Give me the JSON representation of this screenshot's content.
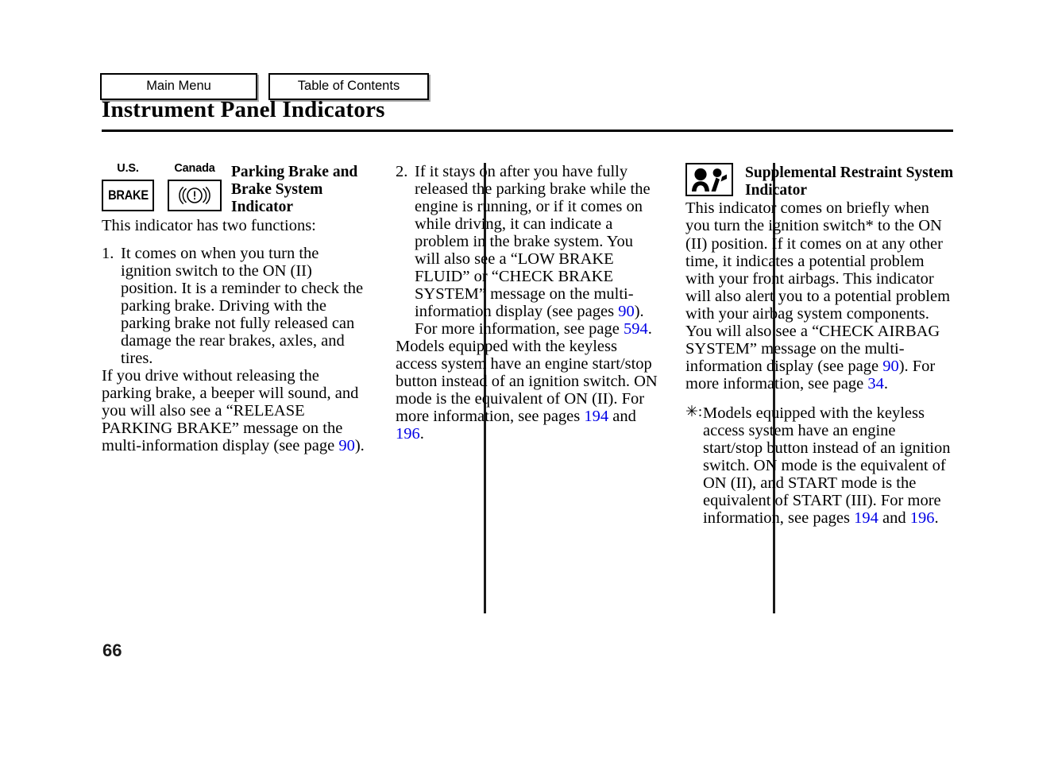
{
  "nav": {
    "main_menu": "Main Menu",
    "table_of_contents": "Table of Contents"
  },
  "page_title": "Instrument Panel Indicators",
  "folio": "66",
  "colors": {
    "link": "#0000e6",
    "rule": "#000000"
  },
  "column_1": {
    "icons": [
      {
        "region": "U.S.",
        "icon_name": "brake-text-indicator",
        "glyph_text": "BRAKE"
      },
      {
        "region": "Canada",
        "icon_name": "brake-circle-exclamation-indicator",
        "glyph_text": ""
      }
    ],
    "heading": "Parking Brake and Brake System Indicator",
    "intro": "This indicator has two functions:",
    "item_1_number": "1.",
    "item_1_text": "It comes on when you turn the ignition switch to the ON (II) position. It is a reminder to check the parking brake. Driving with the parking brake not fully released can damage the rear brakes, axles, and tires.",
    "para_2_a": "If you drive without releasing the parking brake, a beeper will sound, and you will also see a “RELEASE PARKING BRAKE” message on the multi-information display (see page ",
    "para_2_link": "90",
    "para_2_b": ")."
  },
  "column_2": {
    "item_2_number": "2.",
    "item_2_a": "If it stays on after you have fully released the parking brake while the engine is running, or if it comes on while driving, it can indicate a problem in the brake system. You will also see a “LOW BRAKE FLUID” or “CHECK BRAKE SYSTEM” message on the multi-information display (see pages ",
    "item_2_link_1": "90",
    "item_2_b": "). For more information, see page ",
    "item_2_link_2": "594",
    "item_2_c": ".",
    "para_a": "Models equipped with the keyless access system have an engine start/stop button instead of an ignition switch. ON mode is the equivalent of ON (II). For more information, see pages ",
    "para_link_1": "194",
    "para_b": " and ",
    "para_link_2": "196",
    "para_c": "."
  },
  "column_3": {
    "icon_name": "srs-airbag-indicator",
    "heading": "Supplemental Restraint System Indicator",
    "para_1_a": "This indicator comes on briefly when you turn the ignition switch* to the ON (II) position. If it comes on at any other time, it indicates a potential problem with your front airbags. This indicator will also alert you to a potential problem with your airbag system components. You will also see a “CHECK AIRBAG SYSTEM” message on the multi-information display (see page ",
    "para_1_link_1": "90",
    "para_1_b": "). For more information, see page ",
    "para_1_link_2": "34",
    "para_1_c": ".",
    "footnote_marker": "✳:",
    "footnote_a": " Models equipped with the keyless access system have an engine start/stop button instead of an ignition switch. ON mode is the equivalent of ON (II), and START mode is the equivalent of START (III). For more information, see pages ",
    "footnote_link_1": "194",
    "footnote_b": " and ",
    "footnote_link_2": "196",
    "footnote_c": "."
  }
}
